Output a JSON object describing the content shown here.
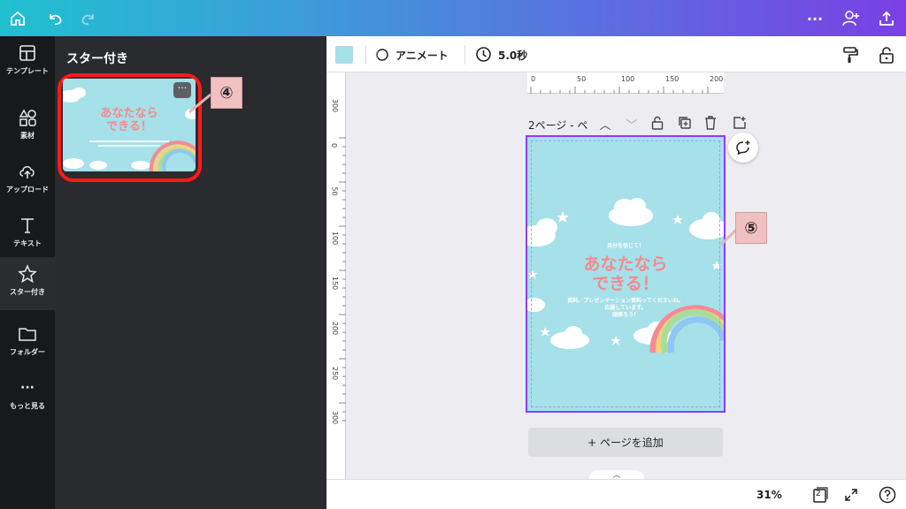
{
  "sidebar": {
    "items": [
      {
        "label": "テンプレート",
        "icon": "template-icon"
      },
      {
        "label": "素材",
        "icon": "elements-icon"
      },
      {
        "label": "アップロード",
        "icon": "upload-icon"
      },
      {
        "label": "テキスト",
        "icon": "text-icon"
      },
      {
        "label": "スター付き",
        "icon": "star-icon"
      },
      {
        "label": "フォルダー",
        "icon": "folder-icon"
      },
      {
        "label": "もっと見る",
        "icon": "more-icon"
      }
    ]
  },
  "panel": {
    "title": "スター付き",
    "thumbnail": {
      "title": "あなたなら\nできる！",
      "more": "···"
    }
  },
  "callouts": {
    "c4": "④",
    "c5": "⑤"
  },
  "toolbar": {
    "swatch_color": "#a6e0e9",
    "animate_label": "アニメート",
    "duration": "5.0秒"
  },
  "ruler": {
    "h": [
      "0",
      "50",
      "100",
      "150",
      "200"
    ],
    "v": [
      "300",
      "0",
      "50",
      "100",
      "150",
      "200",
      "250",
      "300"
    ]
  },
  "page": {
    "label": "2ページ - ペ",
    "design_small_top": "自分を信じて！",
    "design_title": "あなたなら\nできる！",
    "design_body": "資料、プレゼンテーション資料ってくださいね。\n応援しています。\n頑張ろう！"
  },
  "add_page_label": "+ ページを追加",
  "bottom": {
    "zoom": "31%",
    "page_count": "2"
  }
}
